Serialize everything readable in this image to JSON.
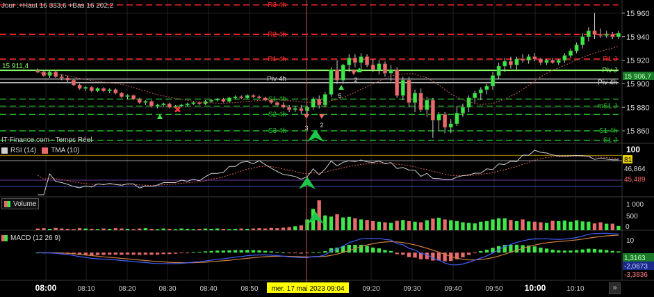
{
  "header": {
    "info": "Jour :+Haut 16 333,6 +Bas 16 202,2"
  },
  "source": "IT-Finance.com - Temps Réel",
  "watermark": "Allemagne 40 - Cash Perm.",
  "colors": {
    "up": "#3ee64a",
    "down": "#e96a6a",
    "level_red": "#ff2a2a",
    "level_green": "#22c02a",
    "rsi_line": "#cfcfcf",
    "tma": "#e06050",
    "macd": "#4060ff",
    "signal": "#d08040",
    "piv": "#d8d8d8",
    "highlight": "#ffff00",
    "grid": "#202020"
  },
  "price_panel": {
    "left_value": "15 911,4",
    "y_ticks": [
      "15 960",
      "15 940",
      "15 920",
      "15 900",
      "15 880",
      "15 860"
    ],
    "current_price_tag": "15 906,7",
    "levels": [
      {
        "label": "R3 4h",
        "value": 15967,
        "style": "red"
      },
      {
        "label": "R2 4h",
        "value": 15942,
        "style": "red"
      },
      {
        "label": "R1 4h",
        "value": 15921,
        "style": "red"
      },
      {
        "label": "Piv 4h",
        "value": 15904,
        "style": "white"
      },
      {
        "label": "S1 4h",
        "value": 15887,
        "style": "green"
      },
      {
        "label": "S2 4h",
        "value": 15874,
        "style": "green"
      },
      {
        "label": "S3 4h",
        "value": 15860,
        "style": "green"
      }
    ],
    "right_levels": [
      {
        "label": "R1 J",
        "value": 15921,
        "style": "red"
      },
      {
        "label": "Piv 4h",
        "value": 15901,
        "style": "white"
      },
      {
        "label": "Piv J",
        "value": 15911.4,
        "style": "green_light"
      },
      {
        "label": "mS1 J",
        "value": 15881,
        "style": "green"
      },
      {
        "label": "S1 4h",
        "value": 15860,
        "style": "green"
      },
      {
        "label": "S1 J",
        "value": 15852,
        "style": "green"
      }
    ],
    "marker_numbers": [
      "3",
      "2",
      "5",
      "2"
    ]
  },
  "rsi_panel": {
    "legend": [
      "RSI (14)",
      "TMA (10)"
    ],
    "y_tick": "100",
    "tags": [
      "81",
      "46,864",
      "45,489"
    ]
  },
  "volume_panel": {
    "legend": "Volume",
    "y_ticks": [
      "1 000",
      "500"
    ],
    "tag": "0"
  },
  "macd_panel": {
    "legend": "MACD (12 26 9)",
    "y_tick": "10",
    "tags": [
      "1,3163",
      "-2,0673",
      "-3,3836"
    ]
  },
  "x_axis": {
    "ticks": [
      "08:00",
      "08:10",
      "08:20",
      "08:30",
      "08:40",
      "08:50",
      "09:20",
      "09:30",
      "09:40",
      "09:50",
      "10:00",
      "10:10"
    ],
    "bold_ticks": [
      "08:00",
      "10:00"
    ],
    "cursor_label": "mer. 17 mai 2023 09:04"
  },
  "chart_data": {
    "type": "candlestick",
    "interval": "1 minute",
    "x_start": "07:58",
    "y_range": [
      15850,
      15970
    ],
    "candles": [
      [
        15911,
        15913,
        15909,
        15910
      ],
      [
        15910,
        15912,
        15906,
        15907
      ],
      [
        15907,
        15911,
        15905,
        15910
      ],
      [
        15910,
        15911,
        15905,
        15906
      ],
      [
        15906,
        15908,
        15903,
        15905
      ],
      [
        15905,
        15907,
        15901,
        15903
      ],
      [
        15903,
        15904,
        15898,
        15899
      ],
      [
        15899,
        15900,
        15895,
        15896
      ],
      [
        15896,
        15898,
        15894,
        15897
      ],
      [
        15897,
        15898,
        15893,
        15894
      ],
      [
        15894,
        15897,
        15893,
        15896
      ],
      [
        15896,
        15897,
        15893,
        15894
      ],
      [
        15894,
        15896,
        15892,
        15895
      ],
      [
        15895,
        15896,
        15891,
        15892
      ],
      [
        15892,
        15893,
        15888,
        15889
      ],
      [
        15889,
        15891,
        15887,
        15890
      ],
      [
        15890,
        15891,
        15886,
        15887
      ],
      [
        15887,
        15888,
        15883,
        15884
      ],
      [
        15884,
        15886,
        15882,
        15885
      ],
      [
        15885,
        15886,
        15880,
        15881
      ],
      [
        15881,
        15883,
        15879,
        15882
      ],
      [
        15882,
        15884,
        15880,
        15883
      ],
      [
        15883,
        15884,
        15879,
        15880
      ],
      [
        15880,
        15882,
        15879,
        15881
      ],
      [
        15881,
        15883,
        15880,
        15882
      ],
      [
        15882,
        15884,
        15881,
        15883
      ],
      [
        15883,
        15885,
        15882,
        15884
      ],
      [
        15884,
        15885,
        15882,
        15883
      ],
      [
        15883,
        15886,
        15882,
        15885
      ],
      [
        15885,
        15887,
        15884,
        15886
      ],
      [
        15886,
        15888,
        15885,
        15887
      ],
      [
        15887,
        15888,
        15884,
        15885
      ],
      [
        15885,
        15889,
        15884,
        15888
      ],
      [
        15888,
        15890,
        15887,
        15889
      ],
      [
        15889,
        15890,
        15887,
        15888
      ],
      [
        15888,
        15891,
        15887,
        15890
      ],
      [
        15890,
        15891,
        15888,
        15889
      ],
      [
        15889,
        15890,
        15887,
        15888
      ],
      [
        15888,
        15889,
        15885,
        15886
      ],
      [
        15886,
        15887,
        15883,
        15884
      ],
      [
        15884,
        15885,
        15881,
        15882
      ],
      [
        15882,
        15884,
        15879,
        15880
      ],
      [
        15880,
        15882,
        15876,
        15878
      ],
      [
        15878,
        15881,
        15876,
        15879
      ],
      [
        15879,
        15882,
        15874,
        15877
      ],
      [
        15877,
        15881,
        15872,
        15880
      ],
      [
        15880,
        15889,
        15878,
        15887
      ],
      [
        15887,
        15890,
        15879,
        15882
      ],
      [
        15882,
        15893,
        15880,
        15891
      ],
      [
        15891,
        15914,
        15889,
        15912
      ],
      [
        15912,
        15920,
        15900,
        15903
      ],
      [
        15903,
        15917,
        15900,
        15916
      ],
      [
        15916,
        15925,
        15910,
        15922
      ],
      [
        15922,
        15925,
        15914,
        15918
      ],
      [
        15918,
        15926,
        15912,
        15923
      ],
      [
        15923,
        15925,
        15914,
        15916
      ],
      [
        15916,
        15921,
        15910,
        15912
      ],
      [
        15912,
        15920,
        15908,
        15917
      ],
      [
        15917,
        15919,
        15906,
        15909
      ],
      [
        15909,
        15916,
        15902,
        15912
      ],
      [
        15912,
        15914,
        15888,
        15890
      ],
      [
        15890,
        15906,
        15886,
        15903
      ],
      [
        15903,
        15906,
        15880,
        15884
      ],
      [
        15884,
        15895,
        15876,
        15892
      ],
      [
        15892,
        15896,
        15876,
        15878
      ],
      [
        15878,
        15889,
        15872,
        15886
      ],
      [
        15886,
        15888,
        15854,
        15869
      ],
      [
        15869,
        15876,
        15860,
        15874
      ],
      [
        15874,
        15876,
        15858,
        15863
      ],
      [
        15863,
        15870,
        15858,
        15866
      ],
      [
        15866,
        15881,
        15864,
        15875
      ],
      [
        15875,
        15883,
        15872,
        15880
      ],
      [
        15880,
        15890,
        15876,
        15888
      ],
      [
        15888,
        15894,
        15884,
        15892
      ],
      [
        15892,
        15897,
        15886,
        15895
      ],
      [
        15895,
        15900,
        15891,
        15898
      ],
      [
        15898,
        15910,
        15895,
        15907
      ],
      [
        15907,
        15918,
        15904,
        15915
      ],
      [
        15915,
        15922,
        15910,
        15919
      ],
      [
        15919,
        15923,
        15913,
        15916
      ],
      [
        15916,
        15923,
        15912,
        15921
      ],
      [
        15921,
        15925,
        15918,
        15920
      ],
      [
        15920,
        15925,
        15917,
        15923
      ],
      [
        15923,
        15926,
        15919,
        15921
      ],
      [
        15921,
        15922,
        15916,
        15918
      ],
      [
        15918,
        15921,
        15916,
        15920
      ],
      [
        15920,
        15922,
        15917,
        15918
      ],
      [
        15918,
        15921,
        15916,
        15920
      ],
      [
        15920,
        15926,
        15918,
        15924
      ],
      [
        15924,
        15930,
        15922,
        15928
      ],
      [
        15928,
        15935,
        15926,
        15933
      ],
      [
        15933,
        15943,
        15930,
        15940
      ],
      [
        15940,
        15948,
        15936,
        15945
      ],
      [
        15945,
        15960,
        15938,
        15942
      ],
      [
        15942,
        15947,
        15939,
        15941
      ],
      [
        15941,
        15945,
        15939,
        15942
      ],
      [
        15942,
        15944,
        15938,
        15940
      ],
      [
        15940,
        15945,
        15938,
        15943
      ],
      [
        15943,
        15945,
        15937,
        15939
      ],
      [
        15939,
        15944,
        15936,
        15942
      ],
      [
        15942,
        15948,
        15938,
        15946
      ]
    ],
    "volume": [
      60,
      70,
      50,
      80,
      60,
      50,
      40,
      70,
      60,
      50,
      40,
      60,
      50,
      70,
      60,
      50,
      40,
      60,
      70,
      50,
      40,
      60,
      50,
      40,
      60,
      50,
      40,
      50,
      60,
      50,
      60,
      50,
      40,
      50,
      60,
      50,
      60,
      70,
      60,
      80,
      70,
      90,
      110,
      140,
      170,
      380,
      750,
      1050,
      520,
      480,
      560,
      450,
      470,
      420,
      380,
      360,
      320,
      300,
      280,
      260,
      330,
      360,
      320,
      300,
      280,
      350,
      410,
      440,
      380,
      350,
      320,
      280,
      260,
      240,
      300,
      320,
      380,
      420,
      420,
      360,
      320,
      380,
      310,
      300,
      280,
      260,
      330,
      320,
      340,
      300,
      350,
      310,
      300,
      240,
      280,
      230,
      230,
      150,
      120,
      100,
      90,
      120,
      110,
      150,
      110,
      90
    ]
  }
}
